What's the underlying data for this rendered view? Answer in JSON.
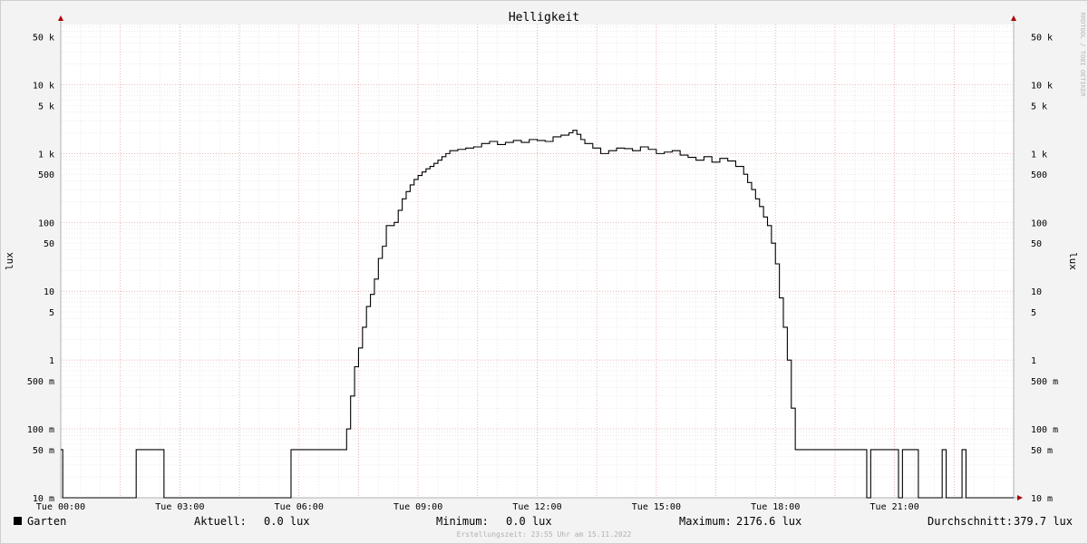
{
  "colors": {
    "background": "#f3f3f3",
    "plot_background": "#ffffff",
    "minor_grid": "#dcdcdc",
    "major_grid": "#e79a9a",
    "series": "#000000",
    "axis": "#b0b0b0",
    "arrow": "#aa0000"
  },
  "watermark": "RRDTOOL / TOBI OETIKER",
  "legend": {
    "series_name": "Garten",
    "aktuell_label": "Aktuell:",
    "aktuell_value": "0.0 lux",
    "minimum_label": "Minimum:",
    "minimum_value": "0.0 lux",
    "maximum_label": "Maximum:",
    "maximum_value": "2176.6 lux",
    "durchschnitt_label": "Durchschnitt:",
    "durchschnitt_value": "379.7 lux"
  },
  "footer": "Erstellungszeit: 23:55 Uhr am 15.11.2022",
  "chart_data": {
    "type": "line",
    "title": "Helligkeit",
    "ylabel": "lux",
    "yscale": "log",
    "ylim": [
      0.01,
      75000
    ],
    "xlim": [
      0,
      24
    ],
    "grid": true,
    "y_ticks": [
      {
        "value": 50000,
        "label": "50 k"
      },
      {
        "value": 10000,
        "label": "10 k"
      },
      {
        "value": 5000,
        "label": "5 k"
      },
      {
        "value": 1000,
        "label": "1 k"
      },
      {
        "value": 500,
        "label": "500"
      },
      {
        "value": 100,
        "label": "100"
      },
      {
        "value": 50,
        "label": "50"
      },
      {
        "value": 10,
        "label": "10"
      },
      {
        "value": 5,
        "label": "5"
      },
      {
        "value": 1,
        "label": "1"
      },
      {
        "value": 0.5,
        "label": "500 m"
      },
      {
        "value": 0.1,
        "label": "100 m"
      },
      {
        "value": 0.05,
        "label": "50 m"
      },
      {
        "value": 0.01,
        "label": "10 m"
      }
    ],
    "x_ticks": [
      {
        "value": 0,
        "label": "Tue 00:00"
      },
      {
        "value": 3,
        "label": "Tue 03:00"
      },
      {
        "value": 6,
        "label": "Tue 06:00"
      },
      {
        "value": 9,
        "label": "Tue 09:00"
      },
      {
        "value": 12,
        "label": "Tue 12:00"
      },
      {
        "value": 15,
        "label": "Tue 15:00"
      },
      {
        "value": 18,
        "label": "Tue 18:00"
      },
      {
        "value": 21,
        "label": "Tue 21:00"
      }
    ],
    "series": [
      {
        "name": "Garten",
        "color": "#000000",
        "step": true,
        "points": [
          [
            0.0,
            0.05
          ],
          [
            0.05,
            0.01
          ],
          [
            1.9,
            0.05
          ],
          [
            2.6,
            0.01
          ],
          [
            5.8,
            0.05
          ],
          [
            7.2,
            0.1
          ],
          [
            7.3,
            0.3
          ],
          [
            7.4,
            0.8
          ],
          [
            7.5,
            1.5
          ],
          [
            7.6,
            3
          ],
          [
            7.7,
            6
          ],
          [
            7.8,
            9
          ],
          [
            7.9,
            15
          ],
          [
            8.0,
            30
          ],
          [
            8.1,
            45
          ],
          [
            8.2,
            90
          ],
          [
            8.4,
            100
          ],
          [
            8.5,
            150
          ],
          [
            8.6,
            220
          ],
          [
            8.7,
            280
          ],
          [
            8.8,
            350
          ],
          [
            8.9,
            420
          ],
          [
            9.0,
            480
          ],
          [
            9.1,
            540
          ],
          [
            9.2,
            600
          ],
          [
            9.3,
            650
          ],
          [
            9.4,
            720
          ],
          [
            9.5,
            800
          ],
          [
            9.6,
            900
          ],
          [
            9.7,
            1000
          ],
          [
            9.8,
            1100
          ],
          [
            10.0,
            1150
          ],
          [
            10.2,
            1200
          ],
          [
            10.4,
            1250
          ],
          [
            10.6,
            1400
          ],
          [
            10.8,
            1500
          ],
          [
            11.0,
            1350
          ],
          [
            11.2,
            1450
          ],
          [
            11.4,
            1550
          ],
          [
            11.6,
            1450
          ],
          [
            11.8,
            1600
          ],
          [
            12.0,
            1550
          ],
          [
            12.2,
            1500
          ],
          [
            12.4,
            1750
          ],
          [
            12.6,
            1850
          ],
          [
            12.8,
            2000
          ],
          [
            12.9,
            2176.6
          ],
          [
            13.0,
            1900
          ],
          [
            13.1,
            1600
          ],
          [
            13.2,
            1400
          ],
          [
            13.4,
            1200
          ],
          [
            13.6,
            1000
          ],
          [
            13.8,
            1100
          ],
          [
            14.0,
            1200
          ],
          [
            14.2,
            1180
          ],
          [
            14.4,
            1100
          ],
          [
            14.6,
            1250
          ],
          [
            14.8,
            1150
          ],
          [
            15.0,
            1000
          ],
          [
            15.2,
            1050
          ],
          [
            15.4,
            1100
          ],
          [
            15.6,
            950
          ],
          [
            15.8,
            880
          ],
          [
            16.0,
            800
          ],
          [
            16.2,
            900
          ],
          [
            16.4,
            750
          ],
          [
            16.6,
            850
          ],
          [
            16.8,
            780
          ],
          [
            17.0,
            650
          ],
          [
            17.2,
            500
          ],
          [
            17.3,
            380
          ],
          [
            17.4,
            300
          ],
          [
            17.5,
            220
          ],
          [
            17.6,
            170
          ],
          [
            17.7,
            120
          ],
          [
            17.8,
            90
          ],
          [
            17.9,
            50
          ],
          [
            18.0,
            25
          ],
          [
            18.1,
            8
          ],
          [
            18.2,
            3
          ],
          [
            18.3,
            1
          ],
          [
            18.4,
            0.2
          ],
          [
            18.5,
            0.05
          ],
          [
            20.3,
            0.01
          ],
          [
            20.4,
            0.05
          ],
          [
            21.1,
            0.01
          ],
          [
            21.2,
            0.05
          ],
          [
            21.6,
            0.01
          ],
          [
            22.2,
            0.05
          ],
          [
            22.3,
            0.01
          ],
          [
            22.7,
            0.05
          ],
          [
            22.8,
            0.01
          ],
          [
            24.0,
            0.01
          ]
        ]
      }
    ]
  }
}
